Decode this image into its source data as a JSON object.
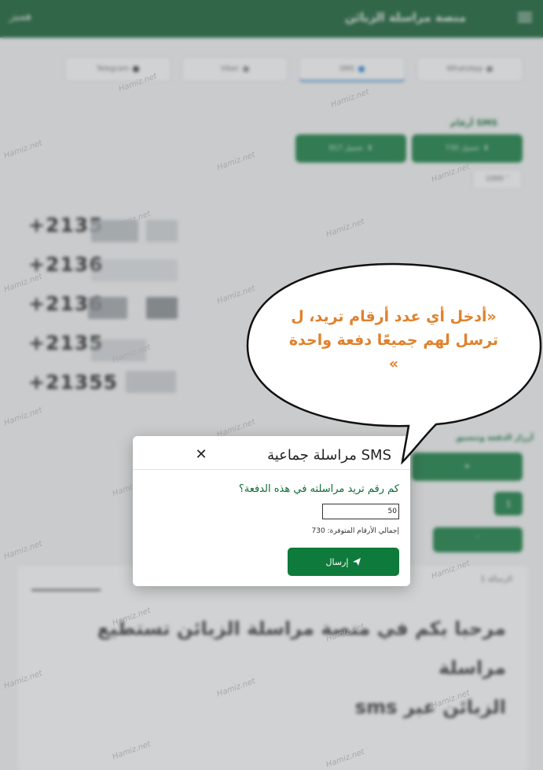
{
  "header": {
    "title": "منصة مراسلة الزبائن",
    "logo_text": "هميز"
  },
  "tabs": [
    {
      "label": "WhatsApp"
    },
    {
      "label": "SMS"
    },
    {
      "label": "Viber"
    },
    {
      "label": "Telegram"
    }
  ],
  "numbers_section": {
    "label": "أرقام SMS"
  },
  "batch_buttons": [
    {
      "label": "تحميل 730"
    },
    {
      "label": "تحميل 917"
    }
  ],
  "mini_select": {
    "value": "1000"
  },
  "phone_numbers": [
    "+2135",
    "+2136",
    "+2136",
    "+2135",
    "+21355"
  ],
  "side_label": "أزرار الدفعة وتنسيق",
  "count_box": {
    "value": "1"
  },
  "message_card": {
    "label": "الرسالة 1",
    "text_line1": "مرحبا بكم في منصة مراسلة الزبائن تستطيع مراسلة",
    "text_line2": "الزبائن عبر sms"
  },
  "modal": {
    "title": "مراسلة جماعية SMS",
    "close_symbol": "✕",
    "question": "كم رقم تريد مراسلته في هذه الدفعة؟",
    "input_value": "50",
    "total_label": "إجمالي الأرقام المتوفرة: 730",
    "send_label": "إرسال"
  },
  "bubble": {
    "line1": "«أدخل أي عدد أرقام تريد، ل",
    "line2": "ترسل لهم جميعًا دفعة واحدة",
    "line3": "»"
  },
  "watermark": "Hamiz.net",
  "colors": {
    "primary_green": "#0e7a3b",
    "header_green": "#0b5a2b",
    "bubble_text": "#e0812c"
  }
}
